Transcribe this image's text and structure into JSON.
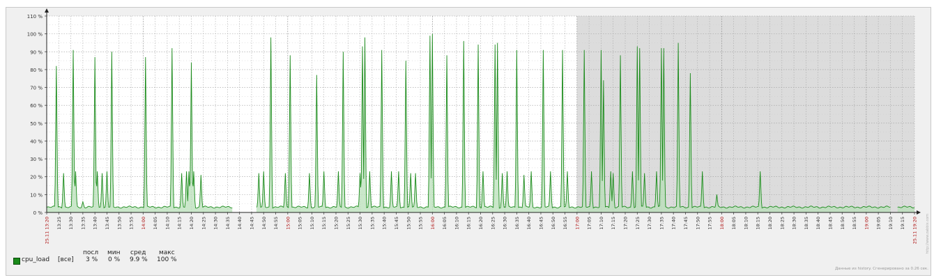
{
  "chart_data": {
    "type": "area",
    "ylim": [
      0,
      110
    ],
    "y_ticks": [
      "0 %",
      "10 %",
      "20 %",
      "30 %",
      "40 %",
      "50 %",
      "60 %",
      "70 %",
      "80 %",
      "90 %",
      "100 %",
      "110 %"
    ],
    "x_range": [
      "13:20",
      "19:20"
    ],
    "x_tick_labels": [
      "13:20",
      "13:25",
      "13:30",
      "13:35",
      "13:40",
      "13:45",
      "13:50",
      "13:55",
      "14:00",
      "14:05",
      "14:10",
      "14:15",
      "14:20",
      "14:25",
      "14:30",
      "14:35",
      "14:40",
      "14:45",
      "14:50",
      "14:55",
      "15:00",
      "15:05",
      "15:10",
      "15:15",
      "15:20",
      "15:25",
      "15:30",
      "15:35",
      "15:40",
      "15:45",
      "15:50",
      "15:55",
      "16:00",
      "16:05",
      "16:10",
      "16:15",
      "16:20",
      "16:25",
      "16:30",
      "16:35",
      "16:40",
      "16:45",
      "16:50",
      "16:55",
      "17:00",
      "17:05",
      "17:10",
      "17:15",
      "17:20",
      "17:25",
      "17:30",
      "17:35",
      "17:40",
      "17:45",
      "17:50",
      "17:55",
      "18:00",
      "18:05",
      "18:10",
      "18:15",
      "18:20",
      "18:25",
      "18:30",
      "18:35",
      "18:40",
      "18:45",
      "18:50",
      "18:55",
      "19:00",
      "19:05",
      "19:10",
      "19:15",
      "19:20"
    ],
    "x_start_label": "25.11 13:20",
    "x_end_label": "25.11 19:20",
    "highlight_ticks": [
      "14:00",
      "15:00",
      "16:00",
      "17:00",
      "18:00",
      "19:00"
    ],
    "shaded_region": [
      "17:00",
      "19:20"
    ],
    "gaps": [
      [
        "14:37",
        "14:47"
      ],
      [
        "19:10",
        "19:13"
      ]
    ],
    "baseline": 3,
    "grid": true,
    "series": [
      {
        "name": "cpu_load",
        "color": "#1a8a1a",
        "fill": "#b8dfb8",
        "spikes": [
          {
            "t": "13:24",
            "v": 82
          },
          {
            "t": "13:27",
            "v": 22
          },
          {
            "t": "13:31",
            "v": 91
          },
          {
            "t": "13:32",
            "v": 23
          },
          {
            "t": "13:35",
            "v": 6
          },
          {
            "t": "13:40",
            "v": 87
          },
          {
            "t": "13:41",
            "v": 23
          },
          {
            "t": "13:43",
            "v": 22
          },
          {
            "t": "13:45",
            "v": 23
          },
          {
            "t": "13:47",
            "v": 90
          },
          {
            "t": "14:01",
            "v": 87
          },
          {
            "t": "14:12",
            "v": 92
          },
          {
            "t": "14:16",
            "v": 22
          },
          {
            "t": "14:18",
            "v": 23
          },
          {
            "t": "14:19",
            "v": 23
          },
          {
            "t": "14:20",
            "v": 84
          },
          {
            "t": "14:21",
            "v": 23
          },
          {
            "t": "14:24",
            "v": 21
          },
          {
            "t": "14:48",
            "v": 22
          },
          {
            "t": "14:50",
            "v": 23
          },
          {
            "t": "14:53",
            "v": 98
          },
          {
            "t": "14:59",
            "v": 22
          },
          {
            "t": "15:01",
            "v": 88
          },
          {
            "t": "15:09",
            "v": 22
          },
          {
            "t": "15:12",
            "v": 77
          },
          {
            "t": "15:15",
            "v": 23
          },
          {
            "t": "15:21",
            "v": 23
          },
          {
            "t": "15:23",
            "v": 90
          },
          {
            "t": "15:30",
            "v": 22
          },
          {
            "t": "15:31",
            "v": 93
          },
          {
            "t": "15:32",
            "v": 98
          },
          {
            "t": "15:34",
            "v": 23
          },
          {
            "t": "15:39",
            "v": 91
          },
          {
            "t": "15:43",
            "v": 23
          },
          {
            "t": "15:46",
            "v": 23
          },
          {
            "t": "15:49",
            "v": 85
          },
          {
            "t": "15:51",
            "v": 22
          },
          {
            "t": "15:53",
            "v": 22
          },
          {
            "t": "15:59",
            "v": 99
          },
          {
            "t": "16:00",
            "v": 100
          },
          {
            "t": "16:06",
            "v": 88
          },
          {
            "t": "16:13",
            "v": 96
          },
          {
            "t": "16:19",
            "v": 94
          },
          {
            "t": "16:21",
            "v": 23
          },
          {
            "t": "16:26",
            "v": 94
          },
          {
            "t": "16:27",
            "v": 95
          },
          {
            "t": "16:29",
            "v": 22
          },
          {
            "t": "16:31",
            "v": 23
          },
          {
            "t": "16:35",
            "v": 91
          },
          {
            "t": "16:38",
            "v": 21
          },
          {
            "t": "16:41",
            "v": 23
          },
          {
            "t": "16:46",
            "v": 91
          },
          {
            "t": "16:49",
            "v": 23
          },
          {
            "t": "16:54",
            "v": 91
          },
          {
            "t": "16:56",
            "v": 23
          },
          {
            "t": "17:03",
            "v": 91
          },
          {
            "t": "17:06",
            "v": 23
          },
          {
            "t": "17:10",
            "v": 91
          },
          {
            "t": "17:11",
            "v": 74
          },
          {
            "t": "17:14",
            "v": 23
          },
          {
            "t": "17:15",
            "v": 22
          },
          {
            "t": "17:18",
            "v": 88
          },
          {
            "t": "17:23",
            "v": 23
          },
          {
            "t": "17:25",
            "v": 93
          },
          {
            "t": "17:26",
            "v": 92
          },
          {
            "t": "17:28",
            "v": 22
          },
          {
            "t": "17:33",
            "v": 23
          },
          {
            "t": "17:35",
            "v": 92
          },
          {
            "t": "17:36",
            "v": 92
          },
          {
            "t": "17:42",
            "v": 95
          },
          {
            "t": "17:47",
            "v": 78
          },
          {
            "t": "17:52",
            "v": 23
          },
          {
            "t": "17:58",
            "v": 10
          },
          {
            "t": "18:16",
            "v": 23
          }
        ]
      }
    ]
  },
  "legend": {
    "item_name": "cpu_load",
    "item_scope": "[все]",
    "headers": {
      "last": "посл",
      "min": "мин",
      "avg": "сред",
      "max": "макс"
    },
    "values": {
      "last": "3 %",
      "min": "0 %",
      "avg": "9.9 %",
      "max": "100 %"
    }
  },
  "footer_note": "Данные из history. Сгенерировано за 0.26 сек.",
  "watermark": "http://www.zabbix.com"
}
